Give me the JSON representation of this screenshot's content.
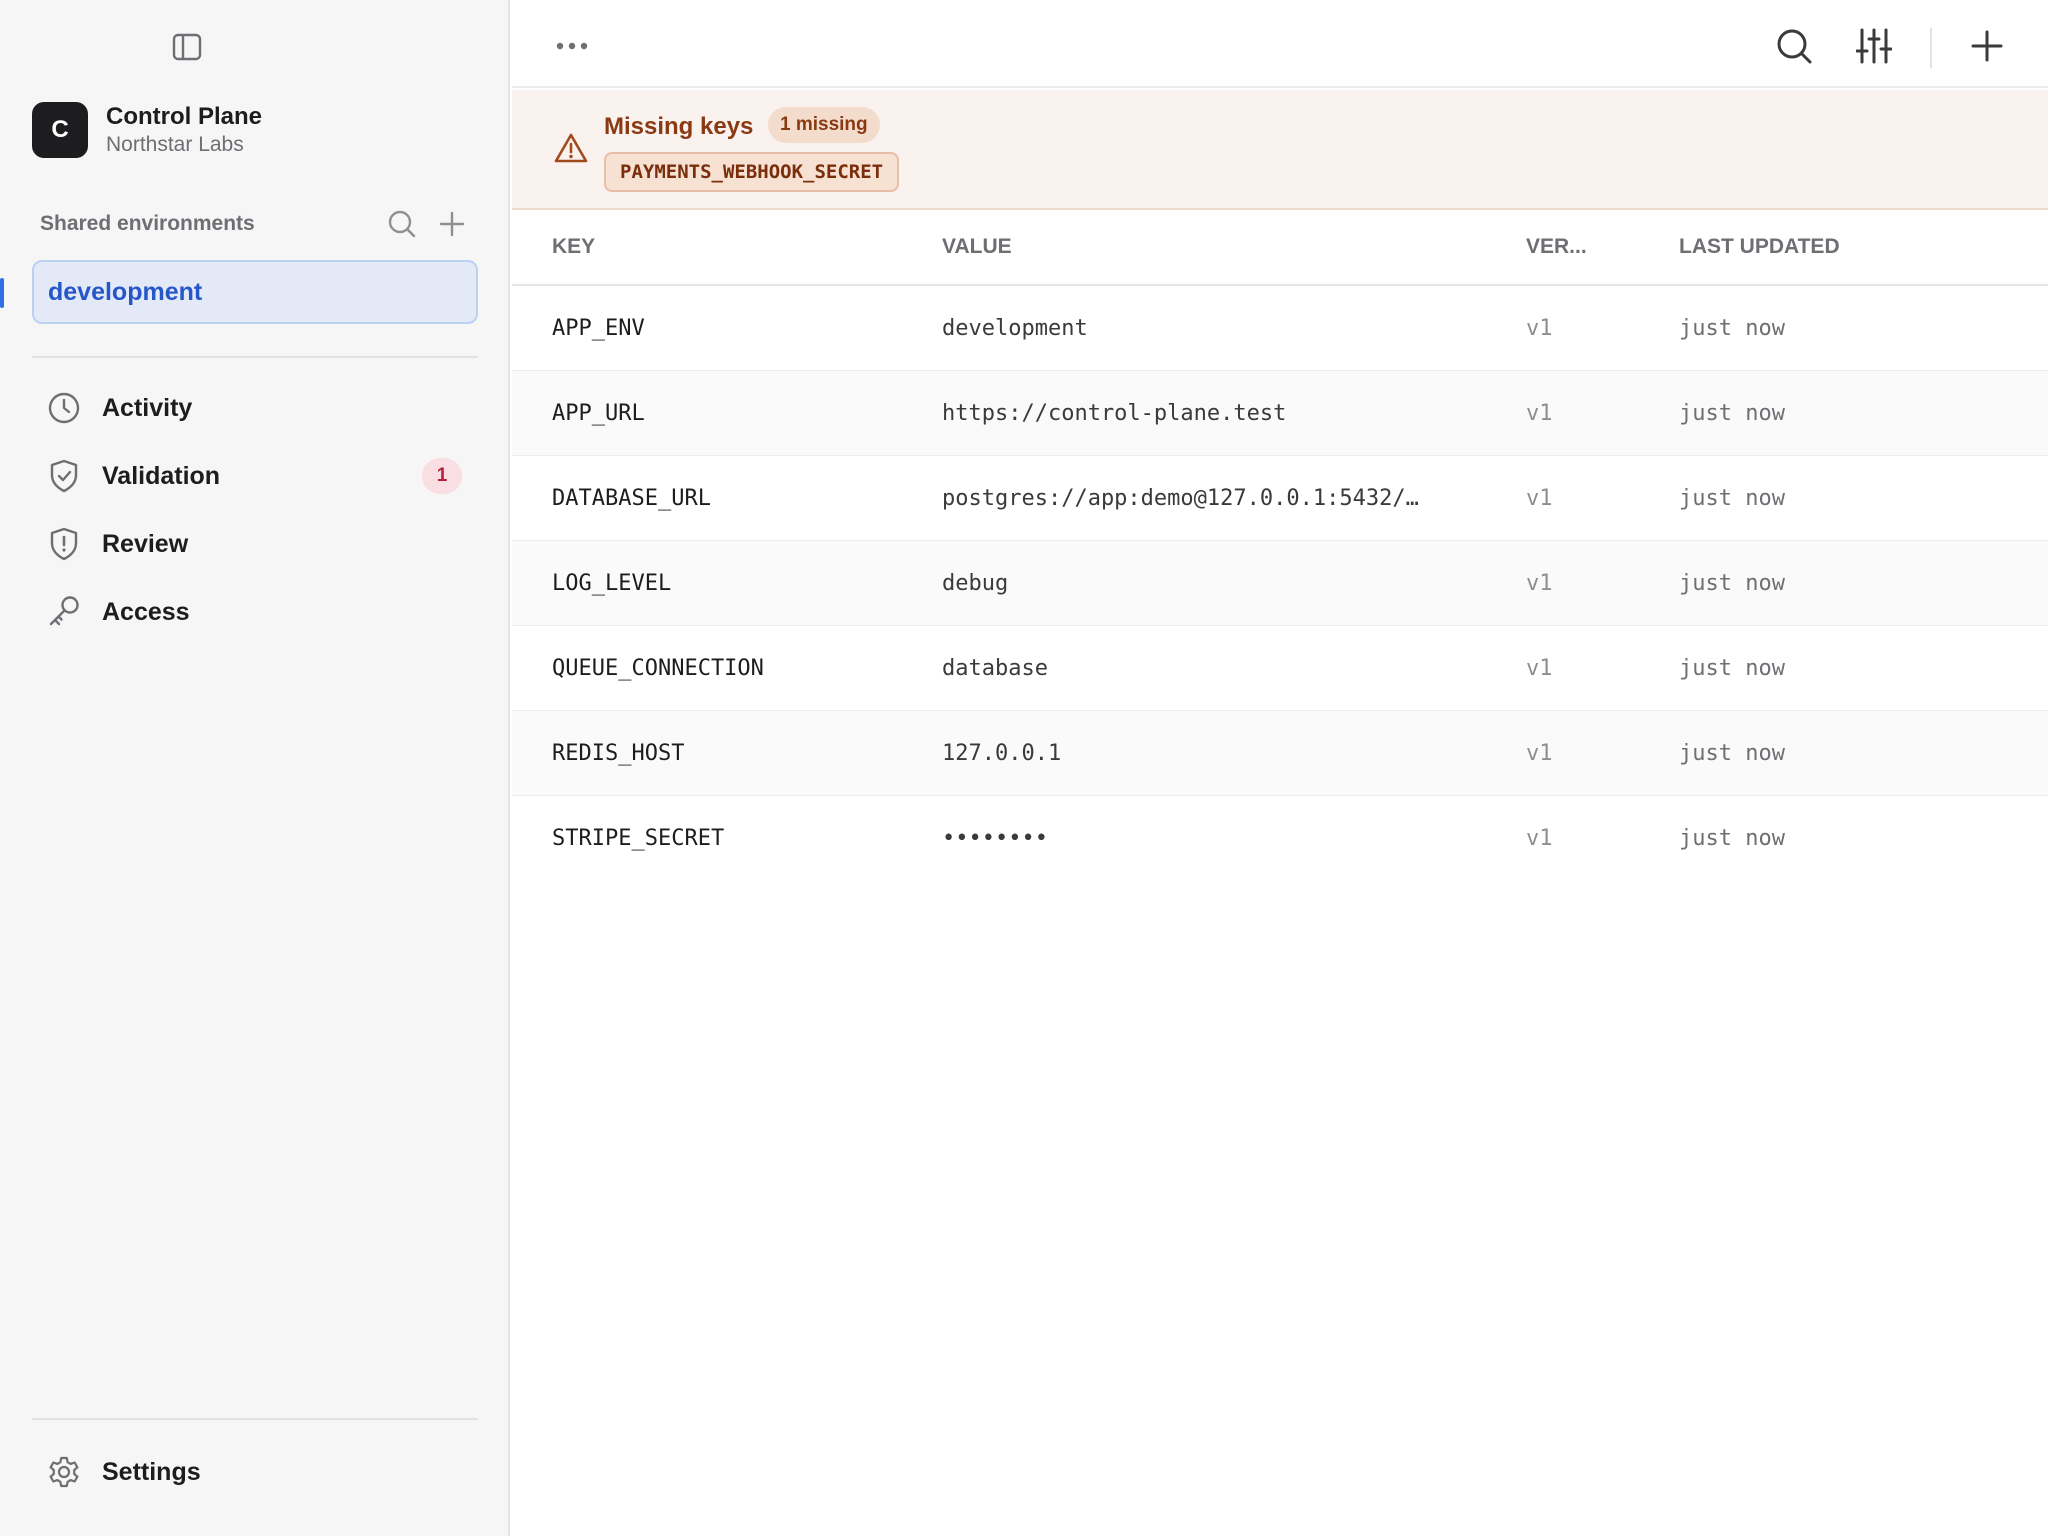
{
  "workspace": {
    "avatar_letter": "C",
    "name": "Control Plane",
    "org": "Northstar Labs"
  },
  "environments": {
    "header": "Shared environments",
    "active": "development"
  },
  "nav": {
    "activity": "Activity",
    "validation": "Validation",
    "validation_badge": "1",
    "review": "Review",
    "access": "Access",
    "settings": "Settings"
  },
  "alert": {
    "title": "Missing keys",
    "count": "1 missing",
    "missing_key": "PAYMENTS_WEBHOOK_SECRET"
  },
  "table": {
    "headers": {
      "key": "KEY",
      "value": "VALUE",
      "version": "VER...",
      "updated": "LAST UPDATED"
    },
    "rows": [
      {
        "key": "APP_ENV",
        "value": "development",
        "version": "v1",
        "updated": "just now"
      },
      {
        "key": "APP_URL",
        "value": "https://control-plane.test",
        "version": "v1",
        "updated": "just now"
      },
      {
        "key": "DATABASE_URL",
        "value": "postgres://app:demo@127.0.0.1:5432/…",
        "version": "v1",
        "updated": "just now"
      },
      {
        "key": "LOG_LEVEL",
        "value": "debug",
        "version": "v1",
        "updated": "just now"
      },
      {
        "key": "QUEUE_CONNECTION",
        "value": "database",
        "version": "v1",
        "updated": "just now"
      },
      {
        "key": "REDIS_HOST",
        "value": "127.0.0.1",
        "version": "v1",
        "updated": "just now"
      },
      {
        "key": "STRIPE_SECRET",
        "value": "••••••••",
        "version": "v1",
        "updated": "just now"
      }
    ]
  },
  "icons": {
    "sidebar_toggle": "sidebar-toggle-icon",
    "more": "more-horizontal-icon",
    "search": "search-icon",
    "filters": "sliders-icon",
    "add": "plus-icon",
    "warning": "warning-triangle-icon",
    "activity": "clock-icon",
    "validation": "shield-check-icon",
    "review": "shield-alert-icon",
    "access": "key-icon",
    "settings": "gear-icon"
  },
  "colors": {
    "accent": "#2f6fe4",
    "active_env_bg": "#e3e9f7",
    "alert_bg": "#f9f2ee",
    "alert_text": "#8a3a12",
    "badge_bg": "#f9dfe3",
    "badge_text": "#b4233b"
  }
}
